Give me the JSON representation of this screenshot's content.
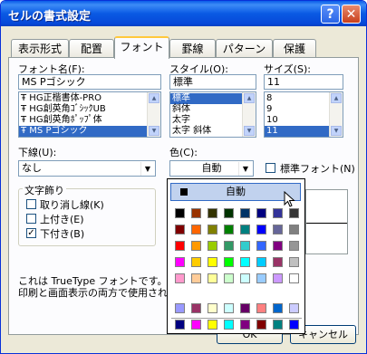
{
  "window": {
    "title": "セルの書式設定",
    "help_glyph": "?",
    "close_glyph": "✕"
  },
  "tabs": [
    {
      "label": "表示形式"
    },
    {
      "label": "配置"
    },
    {
      "label": "フォント"
    },
    {
      "label": "罫線"
    },
    {
      "label": "パターン"
    },
    {
      "label": "保護"
    }
  ],
  "font": {
    "label": "フォント名(F):",
    "value": "MS Pゴシック",
    "items": [
      "HG正楷書体-PRO",
      "HG創英角ｺﾞｼｯｸUB",
      "HG創英角ﾎﾟｯﾌﾟ体",
      "MS Pゴシック"
    ],
    "icon_glyph": "Ŧ"
  },
  "style": {
    "label": "スタイル(O):",
    "value": "標準",
    "items": [
      "標準",
      "斜体",
      "太字",
      "太字 斜体"
    ]
  },
  "size": {
    "label": "サイズ(S):",
    "value": "11",
    "items": [
      "8",
      "9",
      "10",
      "11"
    ]
  },
  "underline": {
    "label": "下線(U):",
    "value": "なし"
  },
  "color": {
    "label": "色(C):",
    "value": "自動",
    "normal_font_label": "標準フォント(N)",
    "auto_label": "自動"
  },
  "effects": {
    "title": "文字飾り",
    "strikethrough": "取り消し線(K)",
    "superscript": "上付き(E)",
    "subscript": "下付き(B)",
    "subscript_checked": true
  },
  "info_text": [
    "これは TrueType フォントです。",
    "印刷と画面表示の両方で使用され"
  ],
  "buttons": {
    "ok": "OK",
    "cancel": "キャンセル"
  },
  "palette_colors": [
    [
      "#000000",
      "#993300",
      "#333300",
      "#003300",
      "#003366",
      "#000080",
      "#333399",
      "#333333"
    ],
    [
      "#800000",
      "#FF6600",
      "#808000",
      "#008000",
      "#008080",
      "#0000FF",
      "#666699",
      "#808080"
    ],
    [
      "#FF0000",
      "#FF9900",
      "#99CC00",
      "#339966",
      "#33CCCC",
      "#3366FF",
      "#800080",
      "#969696"
    ],
    [
      "#FF00FF",
      "#FFCC00",
      "#FFFF00",
      "#00FF00",
      "#00FFFF",
      "#00CCFF",
      "#993366",
      "#C0C0C0"
    ],
    [
      "#FF99CC",
      "#FFCC99",
      "#FFFF99",
      "#CCFFCC",
      "#CCFFFF",
      "#99CCFF",
      "#CC99FF",
      "#FFFFFF"
    ]
  ],
  "palette_chart_colors": [
    [
      "#9999FF",
      "#993366",
      "#FFFFCC",
      "#CCFFFF",
      "#660066",
      "#FF8080",
      "#0066CC",
      "#CCCCFF"
    ],
    [
      "#000080",
      "#FF00FF",
      "#FFFF00",
      "#00FFFF",
      "#800080",
      "#800000",
      "#008080",
      "#0000FF"
    ]
  ]
}
